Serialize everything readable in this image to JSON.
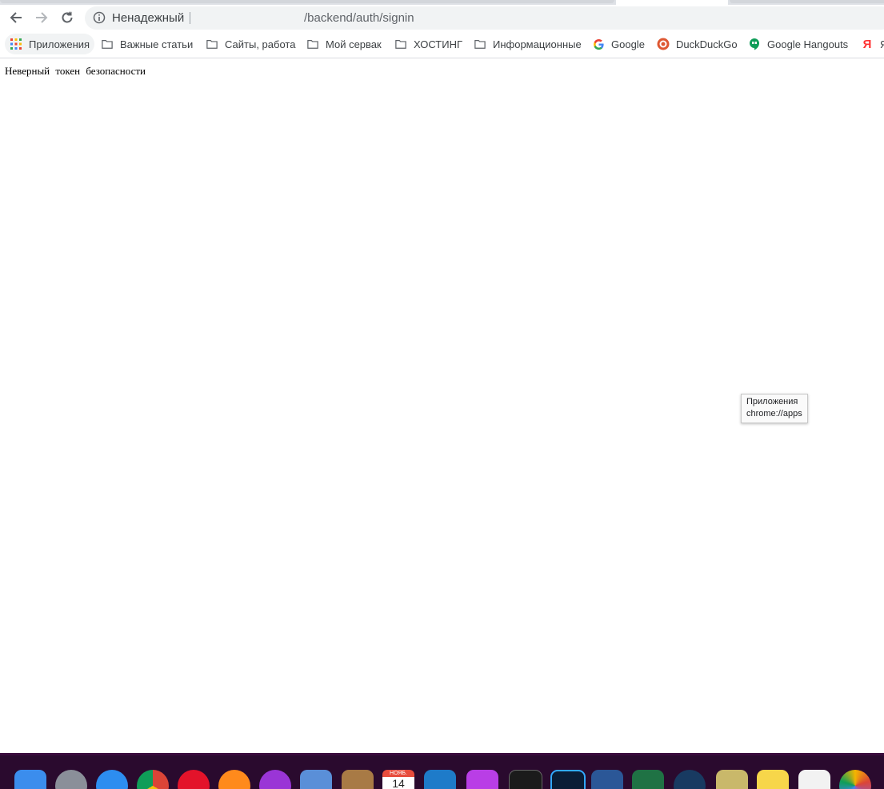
{
  "browser": {
    "security_label": "Ненадежный",
    "url_path": "/backend/auth/signin"
  },
  "bookmarks": [
    {
      "label": "Приложения",
      "icon": "apps-grid-icon"
    },
    {
      "label": "Важные статьи",
      "icon": "folder-icon"
    },
    {
      "label": "Сайты, работа",
      "icon": "folder-icon"
    },
    {
      "label": "Мой сервак",
      "icon": "folder-icon"
    },
    {
      "label": "ХОСТИНГ",
      "icon": "folder-icon"
    },
    {
      "label": "Информационные",
      "icon": "folder-icon"
    },
    {
      "label": "Google",
      "icon": "google-icon"
    },
    {
      "label": "DuckDuckGo",
      "icon": "duckduckgo-icon"
    },
    {
      "label": "Google Hangouts",
      "icon": "hangouts-icon"
    },
    {
      "label": "Я",
      "icon": "yandex-icon"
    }
  ],
  "page": {
    "error_message": "Неверный токен безопасности"
  },
  "tooltip": {
    "line1": "Приложения",
    "line2": "chrome://apps"
  },
  "dock": {
    "calendar_month": "НОЯБ.",
    "calendar_day": "14",
    "icons": [
      "finder-icon",
      "launchpad-icon",
      "safari-icon",
      "chrome-icon",
      "opera-icon",
      "firefox-icon",
      "podcasts-icon",
      "mail-icon",
      "contacts-icon",
      "calendar-icon",
      "vscode-icon",
      "phpstorm-icon",
      "terminal-icon",
      "photoshop-icon",
      "word-icon",
      "excel-icon",
      "virtualbox-icon",
      "archive-icon",
      "notes-icon",
      "reminders-icon",
      "photos-icon"
    ],
    "colors": {
      "background": "#2a0a2e"
    }
  },
  "colors": {
    "omnibox_bg": "#f1f3f4",
    "text_primary": "#3c4043"
  }
}
